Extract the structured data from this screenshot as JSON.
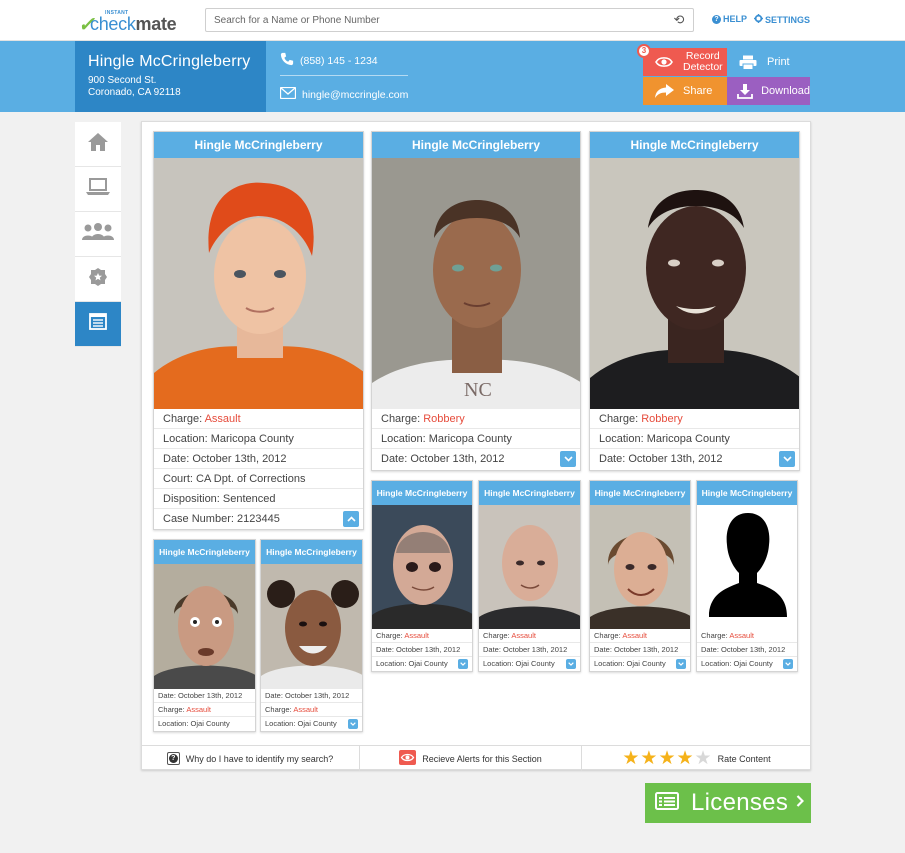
{
  "brand": {
    "instant": "INSTANT",
    "name_part1": "check",
    "name_part2": "mate"
  },
  "search": {
    "placeholder": "Search for a Name or Phone Number"
  },
  "toplinks": {
    "help": "HELP",
    "settings": "SETTINGS"
  },
  "person": {
    "name": "Hingle McCringleberry",
    "address1": "900 Second St.",
    "address2": "Coronado, CA 92118",
    "phone": "(858) 145 - 1234",
    "email": "hingle@mccringle.com"
  },
  "actions": {
    "record_badge": "3",
    "record_line1": "Record",
    "record_line2": "Detector",
    "print": "Print",
    "share": "Share",
    "download": "Download"
  },
  "sidebar": [
    {
      "name": "home-icon"
    },
    {
      "name": "laptop-icon"
    },
    {
      "name": "people-icon"
    },
    {
      "name": "badge-icon"
    },
    {
      "name": "document-icon",
      "active": true
    }
  ],
  "big_cards": [
    {
      "name": "Hingle McCringleberry",
      "rows": [
        {
          "label": "Charge:",
          "value": "Assault",
          "red": true
        },
        {
          "label": "Location:",
          "value": "Maricopa County"
        },
        {
          "label": "Date:",
          "value": "October 13th, 2012"
        },
        {
          "label": "Court:",
          "value": "CA Dpt. of Corrections"
        },
        {
          "label": "Disposition:",
          "value": "Sentenced"
        },
        {
          "label": "Case Number:",
          "value": "2123445"
        }
      ]
    },
    {
      "name": "Hingle McCringleberry",
      "rows": [
        {
          "label": "Charge:",
          "value": "Robbery",
          "red": true
        },
        {
          "label": "Location:",
          "value": "Maricopa County"
        },
        {
          "label": "Date:",
          "value": "October 13th, 2012"
        }
      ]
    },
    {
      "name": "Hingle McCringleberry",
      "rows": [
        {
          "label": "Charge:",
          "value": "Robbery",
          "red": true
        },
        {
          "label": "Location:",
          "value": "Maricopa County"
        },
        {
          "label": "Date:",
          "value": "October 13th, 2012"
        }
      ]
    }
  ],
  "small_cards_a": [
    {
      "name": "Hingle McCringleberry",
      "rows": [
        {
          "label": "Charge:",
          "value": "Assault",
          "red": true
        },
        {
          "label": "Date:",
          "value": "October 13th, 2012"
        },
        {
          "label": "Location:",
          "value": "Ojai County"
        }
      ]
    },
    {
      "name": "Hingle McCringleberry",
      "rows": [
        {
          "label": "Charge:",
          "value": "Assault",
          "red": true
        },
        {
          "label": "Date:",
          "value": "October 13th, 2012"
        },
        {
          "label": "Location:",
          "value": "Ojai County"
        }
      ]
    },
    {
      "name": "Hingle McCringleberry",
      "rows": [
        {
          "label": "Charge:",
          "value": "Assault",
          "red": true
        },
        {
          "label": "Date:",
          "value": "October 13th, 2012"
        },
        {
          "label": "Location:",
          "value": "Ojai County"
        }
      ]
    },
    {
      "name": "Hingle McCringleberry",
      "rows": [
        {
          "label": "Charge:",
          "value": "Assault",
          "red": true
        },
        {
          "label": "Date:",
          "value": "October 13th, 2012"
        },
        {
          "label": "Location:",
          "value": "Ojai County"
        }
      ]
    }
  ],
  "small_cards_b": [
    {
      "name": "Hingle McCringleberry",
      "rows": [
        {
          "label": "Date:",
          "value": "October 13th, 2012"
        },
        {
          "label": "Charge:",
          "value": "Assault",
          "red": true
        },
        {
          "label": "Location:",
          "value": "Ojai County"
        }
      ]
    },
    {
      "name": "Hingle McCringleberry",
      "rows": [
        {
          "label": "Date:",
          "value": "October 13th, 2012"
        },
        {
          "label": "Charge:",
          "value": "Assault",
          "red": true
        },
        {
          "label": "Location:",
          "value": "Ojai County"
        }
      ]
    }
  ],
  "footer": {
    "why": "Why do I have to identify my search?",
    "alerts": "Recieve Alerts for this Section",
    "rate": "Rate Content",
    "rating": 4,
    "rating_max": 5
  },
  "licenses": "Licenses",
  "colors": {
    "accent_blue": "#5aaee3",
    "dark_blue": "#2d86c6",
    "red": "#ef5a50",
    "orange": "#f0932f",
    "purple": "#9b5fc1",
    "green": "#6cc04a",
    "charge_red": "#e64c3c"
  }
}
